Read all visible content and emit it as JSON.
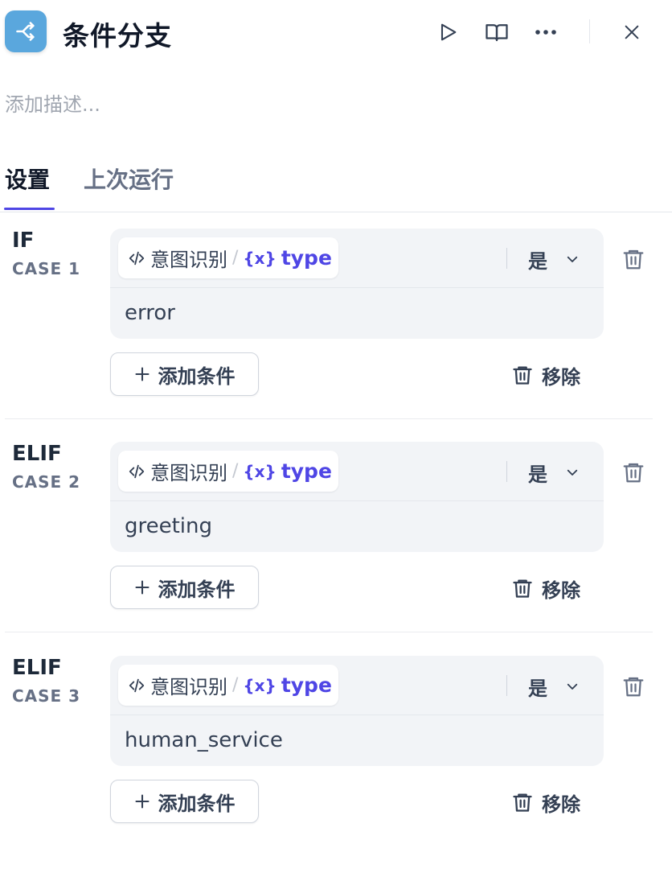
{
  "header": {
    "title": "条件分支",
    "icon": "branch-icon",
    "accent": "#5aa7dd",
    "actions": [
      "play-icon",
      "book-icon",
      "more-icon",
      "close-icon"
    ]
  },
  "description_placeholder": "添加描述...",
  "tabs": [
    {
      "label": "设置",
      "active": true
    },
    {
      "label": "上次运行",
      "active": false
    }
  ],
  "cases": [
    {
      "keyword": "IF",
      "case_label": "CASE 1",
      "variable": {
        "node": "意图识别",
        "separator": "/",
        "symbol": "{x}",
        "name": "type"
      },
      "operator": "是",
      "value": "error",
      "add_label": "添加条件",
      "remove_label": "移除"
    },
    {
      "keyword": "ELIF",
      "case_label": "CASE 2",
      "variable": {
        "node": "意图识别",
        "separator": "/",
        "symbol": "{x}",
        "name": "type"
      },
      "operator": "是",
      "value": "greeting",
      "add_label": "添加条件",
      "remove_label": "移除"
    },
    {
      "keyword": "ELIF",
      "case_label": "CASE 3",
      "variable": {
        "node": "意图识别",
        "separator": "/",
        "symbol": "{x}",
        "name": "type"
      },
      "operator": "是",
      "value": "human_service",
      "add_label": "添加条件",
      "remove_label": "移除"
    }
  ]
}
